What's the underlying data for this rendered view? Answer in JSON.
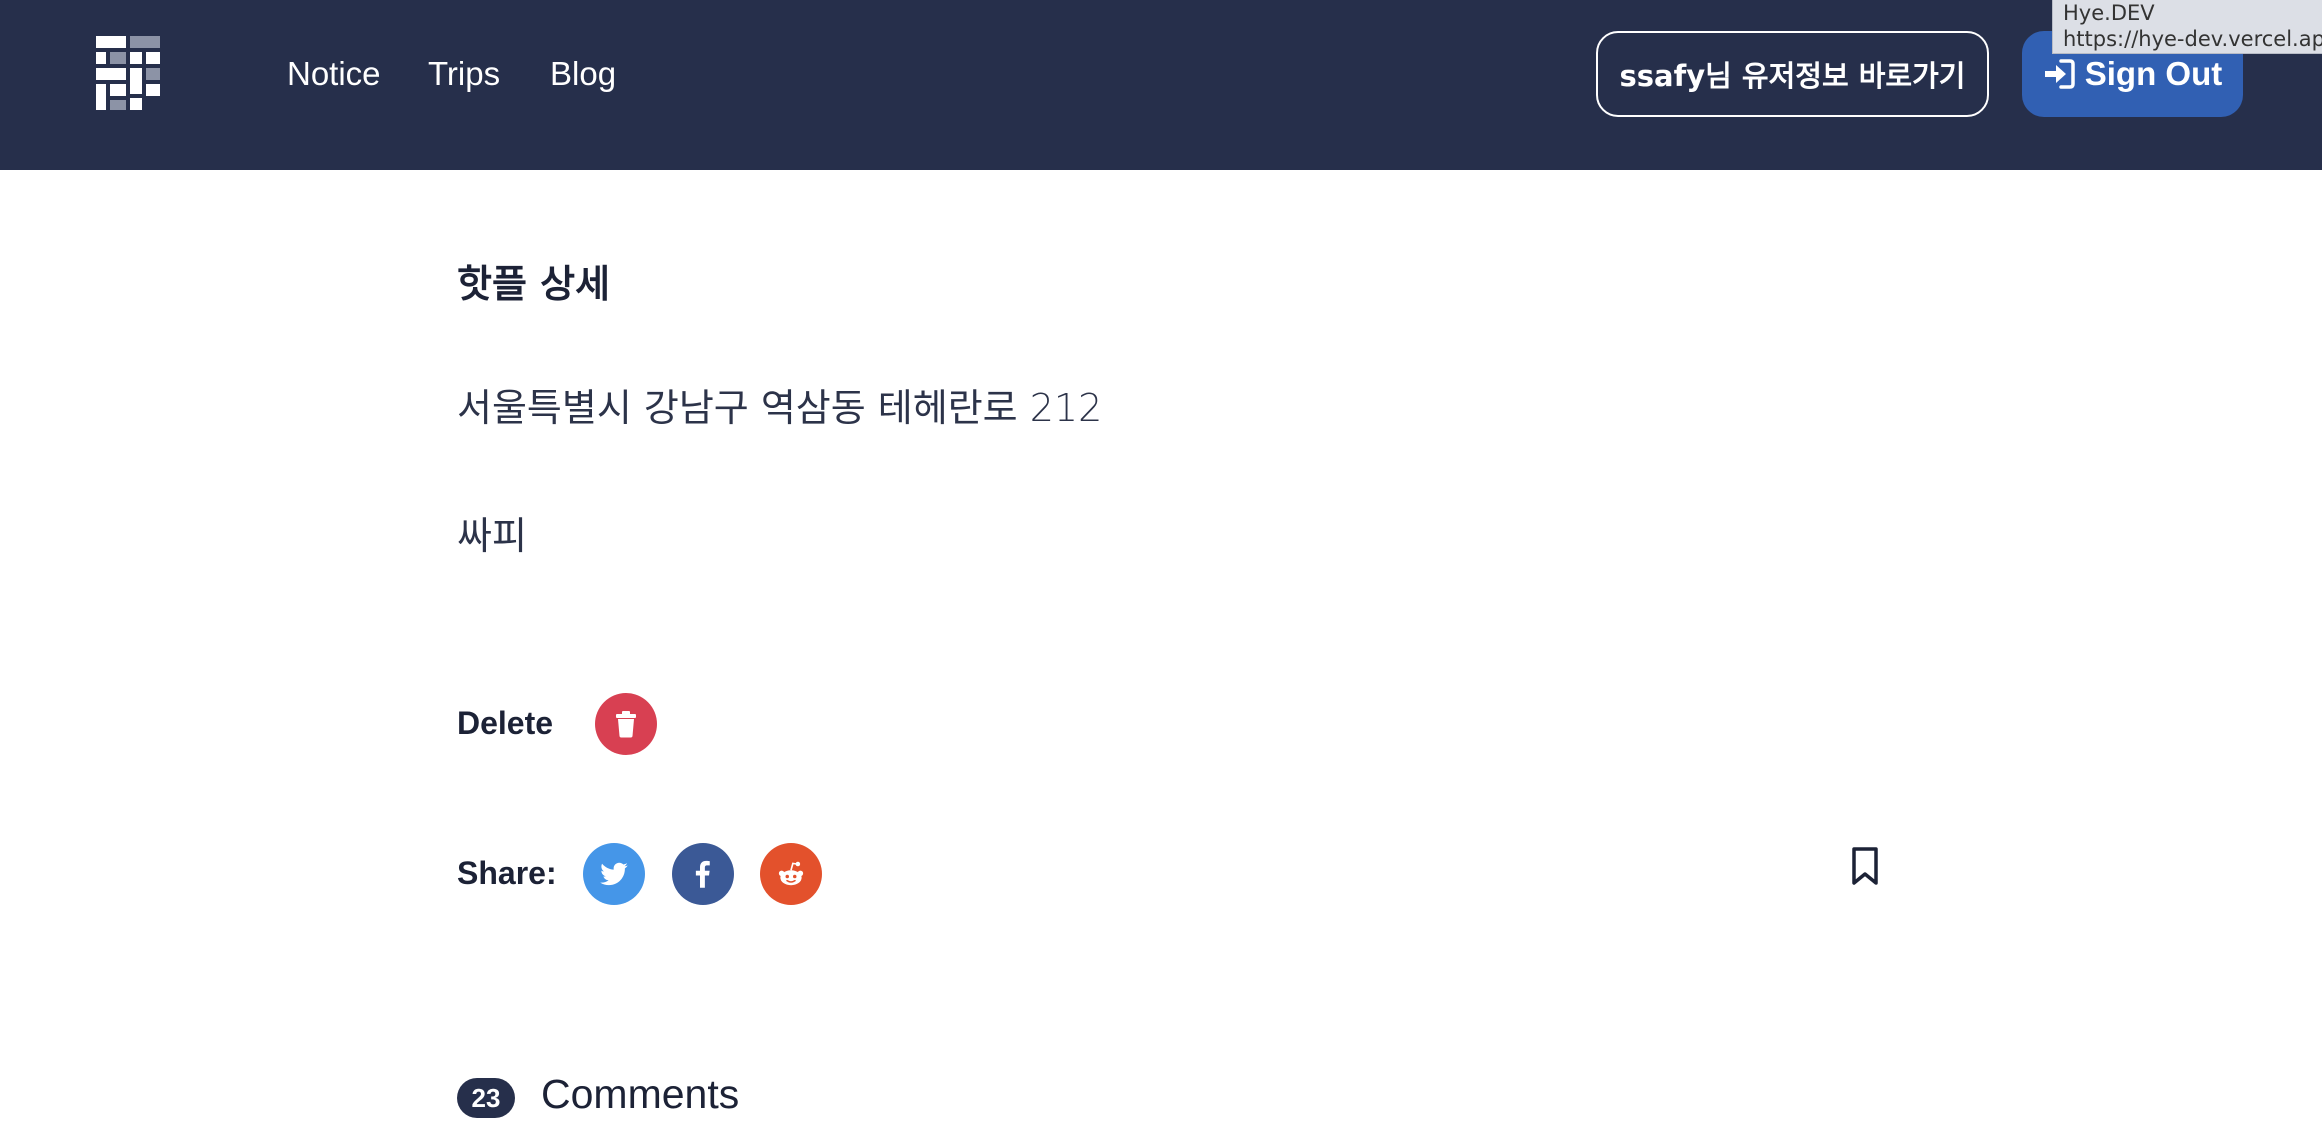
{
  "nav": {
    "links": [
      "Notice",
      "Trips",
      "Blog"
    ],
    "user_info_button": "ssafy님 유저정보 바로가기",
    "sign_out_button": "Sign Out"
  },
  "tooltip": {
    "title": "Hye.DEV",
    "url": "https://hye-dev.vercel.ap"
  },
  "post": {
    "title": "핫플 상세",
    "address": "서울특별시 강남구 역삼동 테헤란로 212",
    "name": "싸피"
  },
  "actions": {
    "delete_label": "Delete",
    "share_label": "Share:"
  },
  "comments": {
    "count": "23",
    "heading": "Comments"
  },
  "icons": {
    "logo": "brand-logo-icon",
    "sign_out": "sign-in-arrow-icon",
    "delete": "trash-icon",
    "twitter": "twitter-icon",
    "facebook": "facebook-icon",
    "reddit": "reddit-icon",
    "bookmark": "bookmark-icon"
  },
  "colors": {
    "navbar": "#262f4b",
    "sign_out": "#3160b3",
    "delete": "#d84052",
    "twitter": "#4596e8",
    "facebook": "#3b5996",
    "reddit": "#e3512c"
  }
}
